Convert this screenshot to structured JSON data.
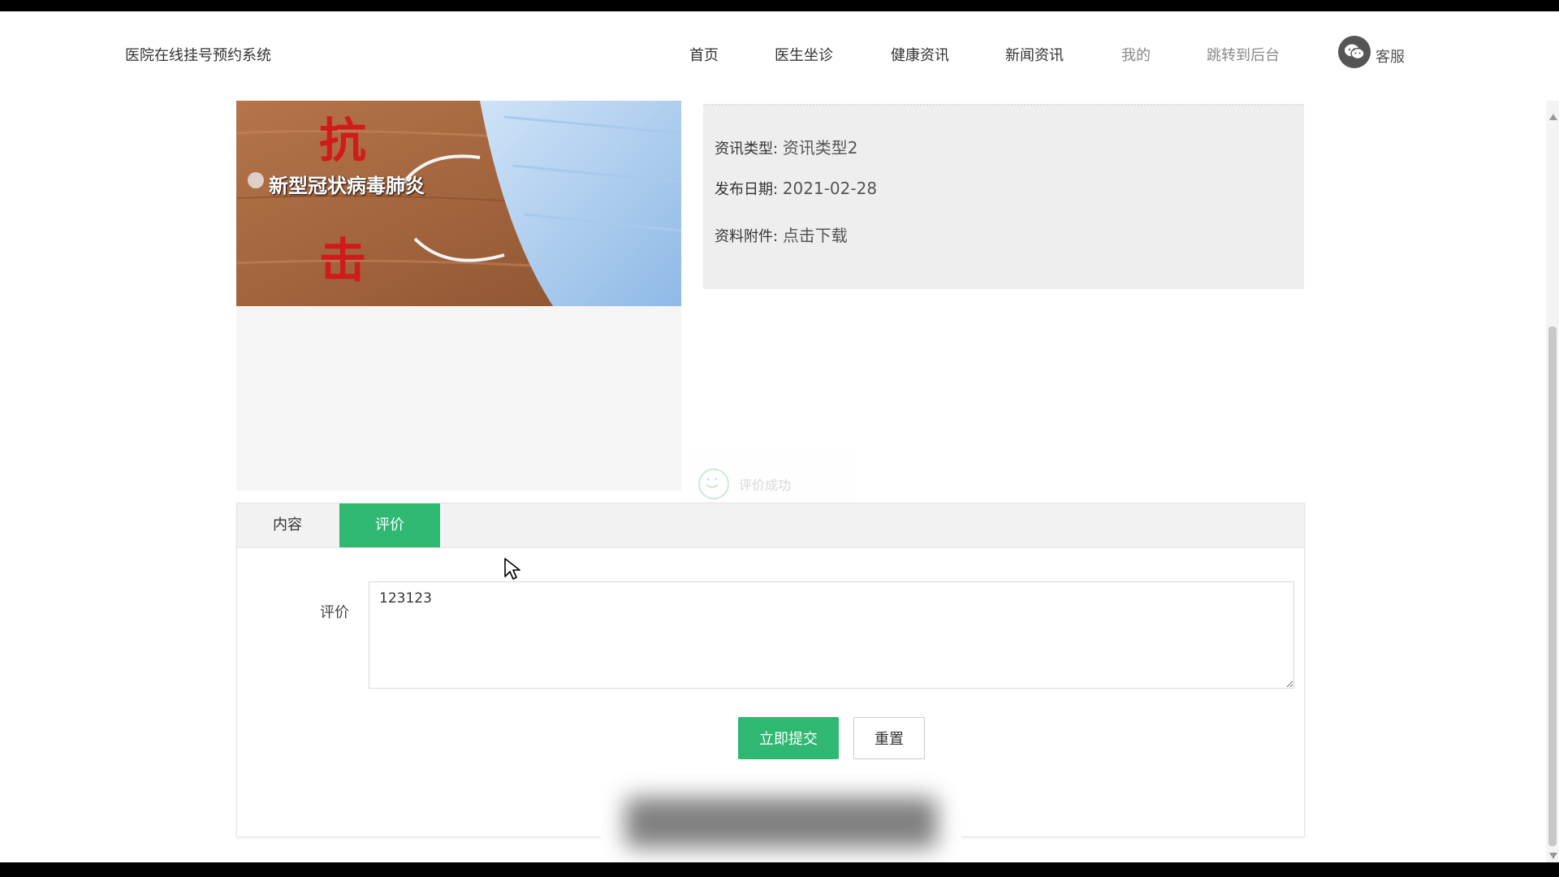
{
  "header": {
    "site_title": "医院在线挂号预约系统",
    "nav": [
      {
        "label": "首页"
      },
      {
        "label": "医生坐诊"
      },
      {
        "label": "健康资讯"
      },
      {
        "label": "新闻资讯"
      },
      {
        "label": "我的"
      },
      {
        "label": "跳转到后台"
      }
    ],
    "service_label": "客服",
    "service_icon": "wechat-icon"
  },
  "news_image": {
    "headline_chars": [
      "抗",
      "击"
    ],
    "caption": "新型冠状病毒肺炎"
  },
  "info": {
    "type_label": "资讯类型:",
    "type_value": "资讯类型2",
    "date_label": "发布日期:",
    "date_value": "2021-02-28",
    "attachment_label": "资料附件:",
    "attachment_value": "点击下载"
  },
  "toast": {
    "text": "评价成功",
    "icon": "smile-icon"
  },
  "tabs": [
    {
      "label": "内容",
      "active": false
    },
    {
      "label": "评价",
      "active": true
    }
  ],
  "comment_form": {
    "label": "评价",
    "value": "123123",
    "submit_label": "立即提交",
    "reset_label": "重置"
  },
  "colors": {
    "accent": "#2eb872",
    "info_bg": "#eeeeee"
  }
}
